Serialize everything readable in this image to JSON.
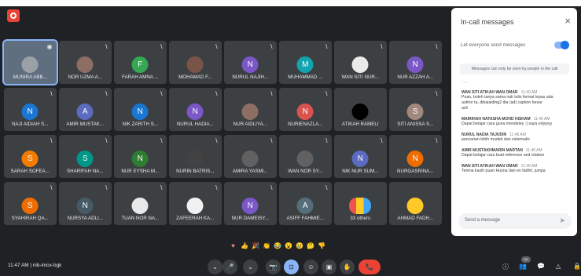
{
  "participants": [
    {
      "name": "MUNIRA ABB...",
      "initial": "",
      "color": "#9aa0a6",
      "kind": "photo",
      "active": true,
      "mic": "◉"
    },
    {
      "name": "NOR UZMA A...",
      "initial": "",
      "color": "#8d6e63",
      "kind": "photo",
      "mic": "\\"
    },
    {
      "name": "FARAH AMNA ...",
      "initial": "F",
      "color": "#34a853",
      "mic": "\\"
    },
    {
      "name": "MOHAMAD F...",
      "initial": "",
      "color": "#795548",
      "kind": "photo",
      "mic": "\\"
    },
    {
      "name": "NURUL NAJIH...",
      "initial": "N",
      "color": "#7b57c7",
      "mic": "\\"
    },
    {
      "name": "MUHAMMAD ...",
      "initial": "M",
      "color": "#12a4af",
      "mic": "\\"
    },
    {
      "name": "WAN SITI NUR...",
      "initial": "",
      "color": "#eaeaea",
      "kind": "photo",
      "mic": "\\"
    },
    {
      "name": "NUR AZZAH A...",
      "initial": "N",
      "color": "#7b57c7",
      "mic": "\\"
    },
    {
      "name": "NAJI AIDIAH S...",
      "initial": "N",
      "color": "#1976d2",
      "mic": "\\"
    },
    {
      "name": "AMIR MUSTAK...",
      "initial": "A",
      "color": "#5c6bc0",
      "mic": "\\"
    },
    {
      "name": "NIK ZARITH S...",
      "initial": "N",
      "color": "#1976d2",
      "mic": "\\"
    },
    {
      "name": "NURUL HADIA...",
      "initial": "N",
      "color": "#7b57c7",
      "mic": "\\"
    },
    {
      "name": "NUR AIDLIYA...",
      "initial": "",
      "color": "#8d6e63",
      "kind": "photo",
      "mic": "\\"
    },
    {
      "name": "NURIENAZLA...",
      "initial": "N",
      "color": "#d9544f",
      "mic": "\\"
    },
    {
      "name": "ATIKAH RAMELI",
      "initial": "",
      "color": "#000000",
      "kind": "dark",
      "mic": ""
    },
    {
      "name": "SITI ANISSA S...",
      "initial": "S",
      "color": "#a1887f",
      "mic": "\\"
    },
    {
      "name": "SARAH SOFEA...",
      "initial": "S",
      "color": "#f57c00",
      "mic": "\\"
    },
    {
      "name": "SHARIFAH NA...",
      "initial": "S",
      "color": "#009688",
      "mic": "\\"
    },
    {
      "name": "NUR EYSHA M...",
      "initial": "N",
      "color": "#2e7d32",
      "mic": "\\"
    },
    {
      "name": "NURIN BATRIS...",
      "initial": "",
      "color": "#424242",
      "kind": "photo",
      "mic": "\\"
    },
    {
      "name": "AMIRA YASMI...",
      "initial": "",
      "color": "#616161",
      "kind": "photo",
      "mic": "\\"
    },
    {
      "name": "WAN NOR SY...",
      "initial": "",
      "color": "#616161",
      "kind": "photo",
      "mic": "\\"
    },
    {
      "name": "NIK NUR SUM...",
      "initial": "N",
      "color": "#5c6bc0",
      "mic": "\\"
    },
    {
      "name": "NURGASRINA...",
      "initial": "N",
      "color": "#ef6c00",
      "mic": "\\"
    },
    {
      "name": "SYAHIRAH QA...",
      "initial": "S",
      "color": "#ef6c00",
      "mic": "\\"
    },
    {
      "name": "NURSYA ADLI...",
      "initial": "N",
      "color": "#455a64",
      "mic": "\\"
    },
    {
      "name": "TUAN NOR NA...",
      "initial": "",
      "color": "#e8e8e8",
      "kind": "white",
      "mic": "\\"
    },
    {
      "name": "ZAFEERAH KA...",
      "initial": "",
      "color": "#f1f1f1",
      "kind": "photo",
      "mic": "\\"
    },
    {
      "name": "NUR DAMEISY...",
      "initial": "N",
      "color": "#7b57c7",
      "mic": "\\"
    },
    {
      "name": "ASIFF FAHMIE...",
      "initial": "A",
      "color": "#546e7a",
      "mic": "\\"
    },
    {
      "name": "33 others",
      "initial": "",
      "color": "#8e24aa",
      "kind": "stack",
      "mic": ""
    },
    {
      "name": "AHMAD FADH...",
      "initial": "",
      "color": "#ffca28",
      "kind": "photo",
      "mic": ""
    }
  ],
  "chat": {
    "title": "In-call messages",
    "close": "×",
    "allow_label": "Let everyone send messages",
    "notice": "Messages can only be seen by people in the call",
    "more": "......",
    "messages": [
      {
        "sender": "WAN SITI ATIKAH WAN OMAR",
        "time": "11:40 AM",
        "lines": [
          "Puan, boleh tanya sama nak tulis format lepas ada",
          "author ta, dibaiaiding2 dia (ad) caption besar",
          "asli"
        ]
      },
      {
        "sender": "MAIRIHAH NATASHA MOHD HISHAM",
        "time": "11:40 AM",
        "lines": [
          "Dapat belajar cara guna mendeley :) saya enjoyyy"
        ]
      },
      {
        "sender": "NURUL NADIA TAJUDIN",
        "time": "11:45 AM",
        "lines": [
          "pencarian lebih mudah dan sistematic"
        ]
      },
      {
        "sender": "AMIR MUSTAKHMARIN MARTAN",
        "time": "11:45 AM",
        "lines": [
          "Dapat belajar cara buat reference and citation"
        ]
      },
      {
        "sender": "WAN SITI ATIKAH WAN OMAR",
        "time": "11:46 AM",
        "lines": [
          "Terima kasih puan Husna dan en fadhil, jumpa"
        ]
      }
    ],
    "send_placeholder": "Send a message",
    "send_icon": "➤"
  },
  "reactions": [
    "♥",
    "👍",
    "🎉",
    "👏",
    "😂",
    "😮",
    "😢",
    "🤔",
    "👎"
  ],
  "meeting": {
    "time": "11:47 AM",
    "separator": "|",
    "code": "nib-imox-bgk"
  },
  "controls": [
    "⌄",
    "🎤",
    "⌄",
    "📷",
    "⊡",
    "☺",
    "▣",
    "✋",
    "⋮",
    "📞"
  ],
  "right_controls": [
    "ⓘ",
    "👥",
    "💬",
    "△",
    "🔒"
  ],
  "right_badge": "64"
}
